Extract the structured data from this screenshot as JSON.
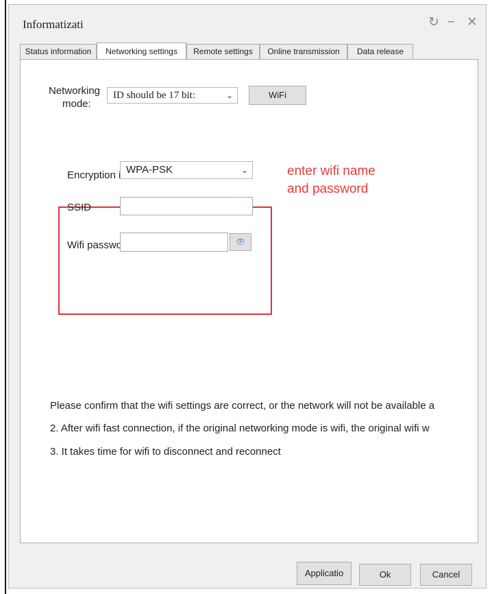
{
  "window": {
    "title": "Informatizati",
    "controls": {
      "refresh_icon": "↻",
      "minimize_icon": "−",
      "close_icon": "✕"
    }
  },
  "tabs": [
    {
      "label": "Status information",
      "active": false
    },
    {
      "label": "Networking settings",
      "active": true
    },
    {
      "label": "Remote settings",
      "active": false
    },
    {
      "label": "Online transmission",
      "active": false
    },
    {
      "label": "Data release",
      "active": false
    }
  ],
  "networking": {
    "mode_label_line1": "Networking",
    "mode_label_line2": "mode:",
    "mode_value": "ID should be 17 bit:",
    "wifi_button": "WiFi"
  },
  "wifi_form": {
    "encryption_label": "Encryption i",
    "encryption_value": "WPA-PSK",
    "ssid_label": "SSID",
    "ssid_value": "",
    "password_label": "Wifi passwo",
    "password_value": "",
    "eye_icon": "👁"
  },
  "annotation": {
    "line1": "enter wifi name",
    "line2": "and password",
    "color": "#e0303a"
  },
  "notes": [
    "Please confirm that the wifi settings are correct, or the network will not be available a",
    "2. After wifi fast connection, if the original networking mode is wifi, the original wifi w",
    "3. It takes time for wifi to disconnect and reconnect"
  ],
  "footer": {
    "apply_label": "Applicatio",
    "ok_label": "Ok",
    "cancel_label": "Cancel"
  }
}
